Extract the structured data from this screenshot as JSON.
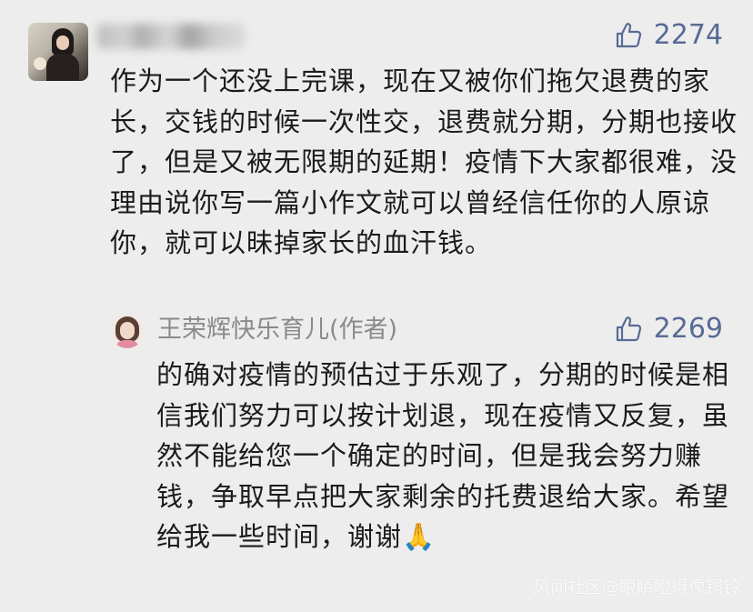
{
  "comment": {
    "likes": "2274",
    "text": "作为一个还没上完课，现在又被你们拖欠退费的家长，交钱的时候一次性交，退费就分期，分期也接收了，但是又被无限期的延期！疫情下大家都很难，没理由说你写一篇小作文就可以曾经信任你的人原谅你，就可以昧掉家长的血汗钱。"
  },
  "reply": {
    "author": "王荣辉快乐育儿(作者)",
    "likes": "2269",
    "text": "的确对疫情的预估过于乐观了，分期的时候是相信我们努力可以按计划退，现在疫情又反复，虽然不能给您一个确定的时间，但是我会努力赚钱，争取早点把大家剩余的托费退给大家。希望给我一些时间，谢谢🙏"
  },
  "watermark": "风闻社区@眼睛瞪得像铜铃",
  "colors": {
    "background": "#ededed",
    "like_blue": "#576b95",
    "text": "#1b1b1b",
    "author_gray": "#8a8a8a"
  },
  "icons": {
    "like": "thumbs-up-icon"
  }
}
